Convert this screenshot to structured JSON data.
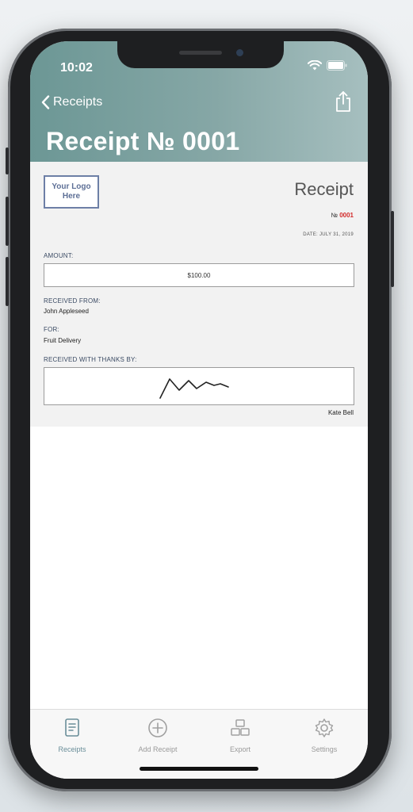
{
  "status": {
    "time": "10:02"
  },
  "nav": {
    "back_label": "Receipts"
  },
  "page": {
    "title": "Receipt № 0001"
  },
  "receipt": {
    "logo_text": "Your Logo Here",
    "heading": "Receipt",
    "number_prefix": "№",
    "number": "0001",
    "date": "DATE: JULY 31, 2019",
    "amount_label": "AMOUNT:",
    "amount_value": "$100.00",
    "received_from_label": "RECEIVED FROM:",
    "received_from_value": "John Appleseed",
    "for_label": "FOR:",
    "for_value": "Fruit Delivery",
    "thanks_label": "RECEIVED WITH THANKS BY:",
    "signer": "Kate Bell"
  },
  "tabbar": {
    "items": [
      {
        "label": "Receipts",
        "icon": "receipt-icon",
        "active": true
      },
      {
        "label": "Add Receipt",
        "icon": "plus-circle-icon",
        "active": false
      },
      {
        "label": "Export",
        "icon": "export-icon",
        "active": false
      },
      {
        "label": "Settings",
        "icon": "gear-icon",
        "active": false
      }
    ]
  },
  "colors": {
    "header_start": "#6c9795",
    "header_end": "#a6bfbf",
    "accent_active": "#6a8e99",
    "receipt_number": "#d22a2a"
  }
}
